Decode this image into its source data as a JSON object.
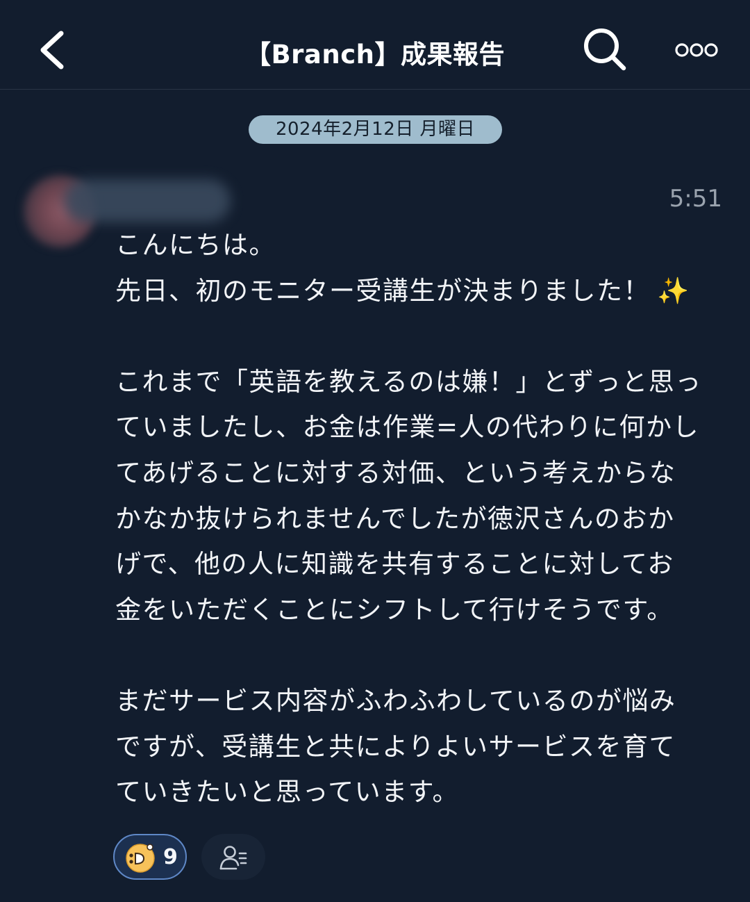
{
  "header": {
    "title": "【Branch】成果報告",
    "back_icon": "chevron-left-icon",
    "search_icon": "search-icon",
    "more_icon": "more-dots-icon"
  },
  "date_separator": "2024年2月12日 月曜日",
  "message": {
    "time": "5:51",
    "lines": [
      "こんにちは。",
      "先日、初のモニター受講生が決まりました！",
      "",
      "これまで「英語を教えるのは嫌！」とずっと思っ",
      "ていましたし、お金は作業=人の代わりに何かし",
      "てあげることに対する対価、という考えからな",
      "かなか抜けられませんでしたが徳沢さんのおか",
      "げで、他の人に知識を共有することに対してお",
      "金をいただくことにシフトして行けそうです。",
      "",
      "まだサービス内容がふわふわしているのが悩み",
      "ですが、受講生と共によりよいサービスを育て",
      "ていきたいと思っています。"
    ],
    "emoji": "✨"
  },
  "reactions": {
    "count": "9",
    "icon": "reaction-face-icon",
    "readers_icon": "readers-icon"
  },
  "colors": {
    "background": "#121d2e",
    "date_pill": "#9fbccd",
    "reaction_border": "#5f88c7"
  }
}
